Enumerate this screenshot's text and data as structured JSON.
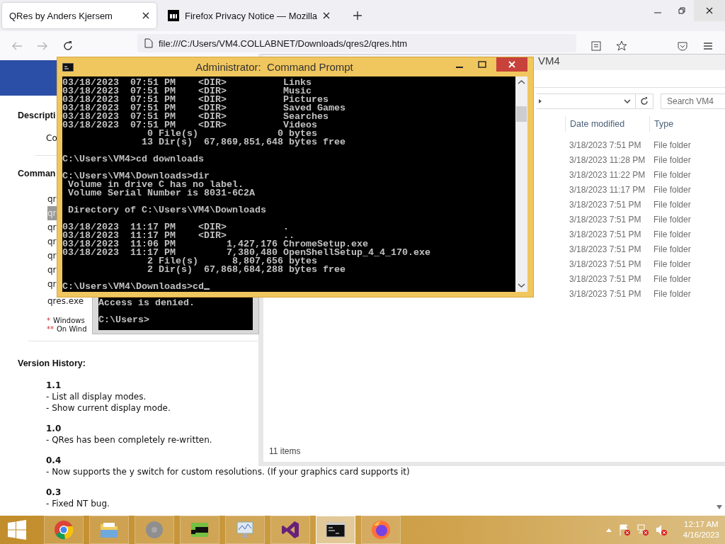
{
  "browser": {
    "tabs": [
      {
        "title": "QRes by Anders Kjersem",
        "selected": true
      },
      {
        "title": "Firefox Privacy Notice — Mozilla",
        "selected": false
      }
    ],
    "url": "file:///C:/Users/VM4.COLLABNET/Downloads/qres2/qres.htm",
    "page": {
      "description_heading": "Descripti",
      "description_text": "Co",
      "commands_heading": "Comman",
      "commands": [
        {
          "text": "qr",
          "selected": false
        },
        {
          "text": "qr",
          "selected": true
        },
        {
          "text": "qr",
          "selected": false
        },
        {
          "text": "qr",
          "selected": false
        },
        {
          "text": "qr",
          "selected": false
        },
        {
          "text": "qr",
          "selected": false
        },
        {
          "text": "qr",
          "selected": false
        },
        {
          "text": "qres.exe",
          "selected": false
        }
      ],
      "notes": [
        {
          "marker": "*",
          "text": "Windows"
        },
        {
          "marker": "**",
          "text": "On Wind"
        }
      ],
      "history_heading": "Version History:",
      "versions": [
        {
          "version": "1.1",
          "changes": [
            "- List all display modes.",
            "- Show current display mode."
          ]
        },
        {
          "version": "1.0",
          "changes": [
            "- QRes has been completely re-written."
          ]
        },
        {
          "version": "0.4",
          "changes": [
            "- Now supports the y switch for custom resolutions. (If your graphics card supports it)"
          ]
        },
        {
          "version": "0.3",
          "changes": [
            "- Fixed NT bug."
          ]
        }
      ]
    }
  },
  "explorer": {
    "title": "VM4",
    "search_placeholder": "Search VM4",
    "columns": [
      "Date modified",
      "Type"
    ],
    "rows": [
      {
        "date_modified": "3/18/2023 7:51 PM",
        "type": "File folder"
      },
      {
        "date_modified": "3/18/2023 11:28 PM",
        "type": "File folder"
      },
      {
        "date_modified": "3/18/2023 11:22 PM",
        "type": "File folder"
      },
      {
        "date_modified": "3/18/2023 11:17 PM",
        "type": "File folder"
      },
      {
        "date_modified": "3/18/2023 7:51 PM",
        "type": "File folder"
      },
      {
        "date_modified": "3/18/2023 7:51 PM",
        "type": "File folder"
      },
      {
        "date_modified": "3/18/2023 7:51 PM",
        "type": "File folder"
      },
      {
        "date_modified": "3/18/2023 7:51 PM",
        "type": "File folder"
      },
      {
        "date_modified": "3/18/2023 7:51 PM",
        "type": "File folder"
      },
      {
        "date_modified": "3/18/2023 7:51 PM",
        "type": "File folder"
      },
      {
        "date_modified": "3/18/2023 7:51 PM",
        "type": "File folder"
      }
    ],
    "status": "11 items"
  },
  "background_console": {
    "output": "Access is denied.\n\nC:\\Users>"
  },
  "admin_console": {
    "title": "Administrator:  Command Prompt",
    "output": "03/18/2023  07:51 PM    <DIR>          Links\n03/18/2023  07:51 PM    <DIR>          Music\n03/18/2023  07:51 PM    <DIR>          Pictures\n03/18/2023  07:51 PM    <DIR>          Saved Games\n03/18/2023  07:51 PM    <DIR>          Searches\n03/18/2023  07:51 PM    <DIR>          Videos\n               0 File(s)              0 bytes\n              13 Dir(s)  67,869,851,648 bytes free\n\nC:\\Users\\VM4>cd downloads\n\nC:\\Users\\VM4\\Downloads>dir\n Volume in drive C has no label.\n Volume Serial Number is 8031-6C2A\n\n Directory of C:\\Users\\VM4\\Downloads\n\n03/18/2023  11:17 PM    <DIR>          .\n03/18/2023  11:17 PM    <DIR>          ..\n03/18/2023  11:06 PM         1,427,176 ChromeSetup.exe\n03/18/2023  11:17 PM         7,380,480 OpenShellSetup_4_4_170.exe\n               2 File(s)      8,807,656 bytes\n               2 Dir(s)  67,868,684,288 bytes free\n\nC:\\Users\\VM4\\Downloads>cd"
  },
  "taskbar": {
    "apps": [
      {
        "kind": "chrome",
        "selected": false
      },
      {
        "kind": "folder",
        "selected": false
      },
      {
        "kind": "disc",
        "selected": false
      },
      {
        "kind": "tile",
        "selected": false
      },
      {
        "kind": "monitor",
        "selected": false
      },
      {
        "kind": "studio",
        "selected": false
      },
      {
        "kind": "terminal",
        "selected": true
      },
      {
        "kind": "firefox",
        "selected": false
      }
    ],
    "time": "12:17 AM",
    "date": "4/16/2023"
  }
}
